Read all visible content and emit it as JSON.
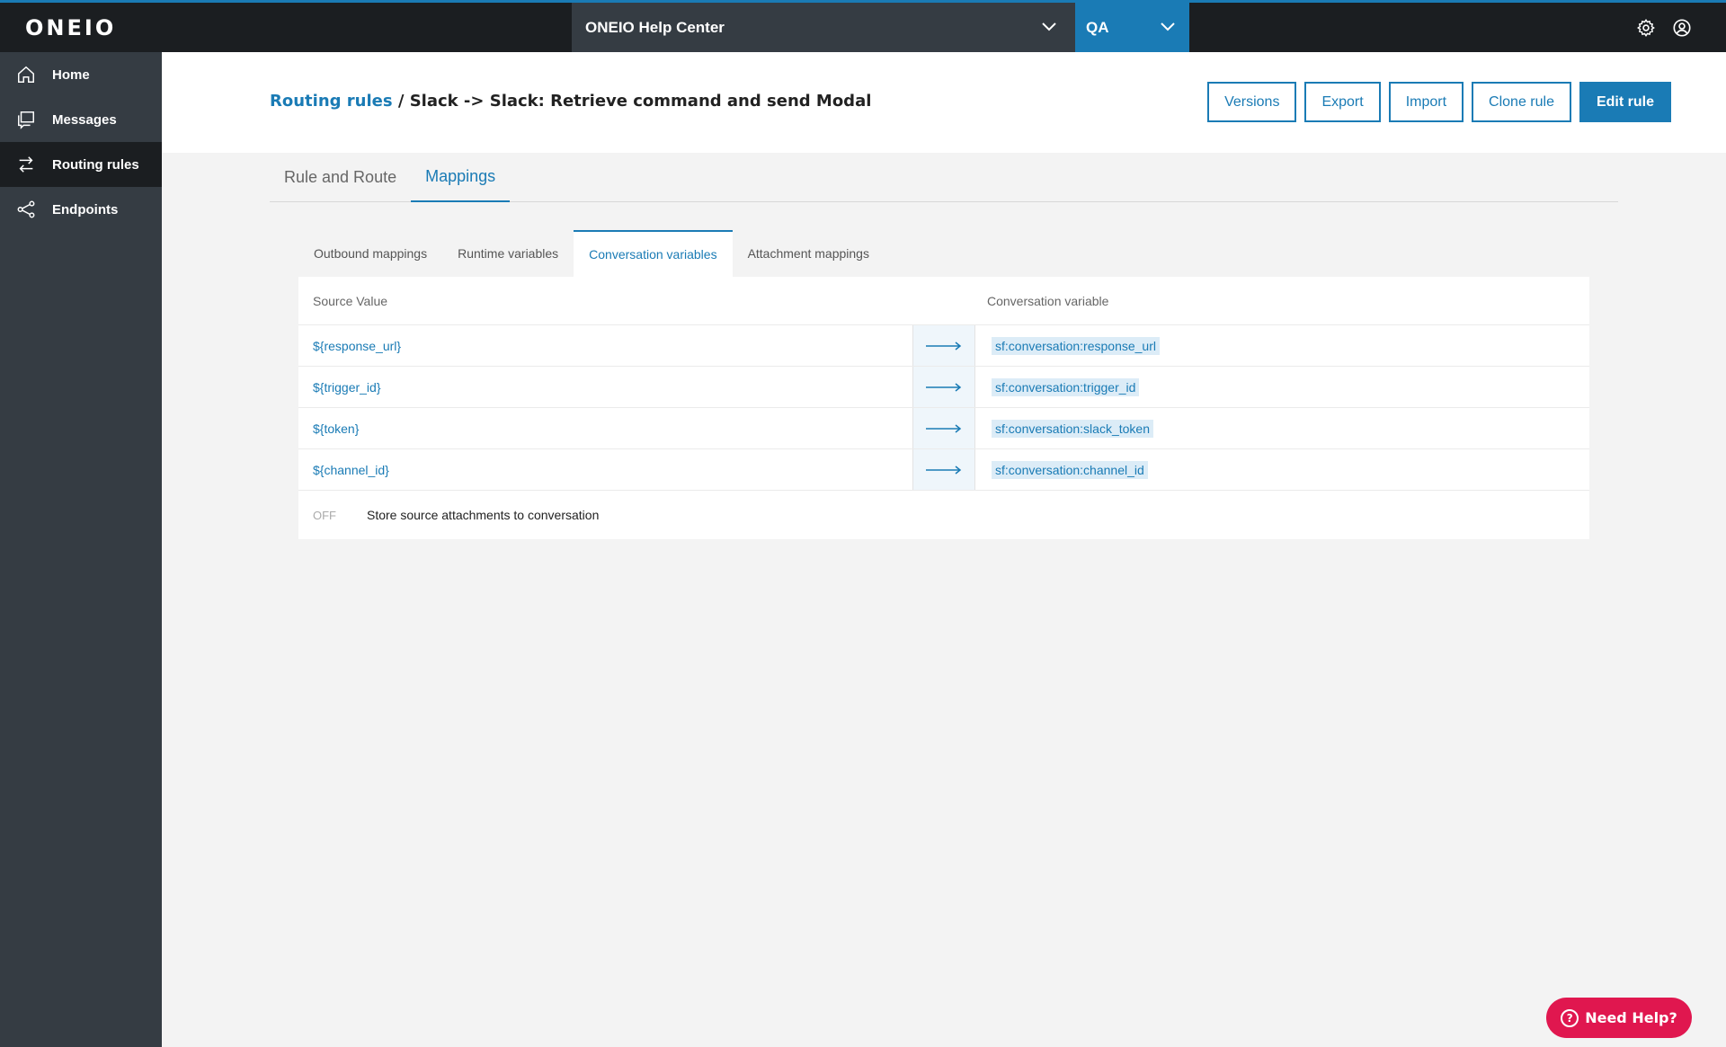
{
  "brand": {
    "logo": "ONEIO",
    "accent": "#1a7bb5",
    "help_color": "#e0174f"
  },
  "topbar": {
    "org": "ONEIO Help Center",
    "env": "QA",
    "icons": [
      "gear-icon",
      "user-account-icon"
    ]
  },
  "sidebar": {
    "items": [
      {
        "label": "Home",
        "icon": "home-icon"
      },
      {
        "label": "Messages",
        "icon": "messages-icon"
      },
      {
        "label": "Routing rules",
        "icon": "routing-icon",
        "active": true
      },
      {
        "label": "Endpoints",
        "icon": "endpoints-icon"
      }
    ]
  },
  "header": {
    "breadcrumb_link": "Routing rules",
    "separator": "/",
    "title": "Slack -> Slack: Retrieve command and send Modal",
    "buttons": {
      "versions": "Versions",
      "export": "Export",
      "import": "Import",
      "clone": "Clone rule",
      "edit": "Edit rule"
    }
  },
  "main_tabs": [
    {
      "label": "Rule and Route",
      "active": false
    },
    {
      "label": "Mappings",
      "active": true
    }
  ],
  "sub_tabs": [
    {
      "label": "Outbound mappings",
      "active": false
    },
    {
      "label": "Runtime variables",
      "active": false
    },
    {
      "label": "Conversation variables",
      "active": true
    },
    {
      "label": "Attachment mappings",
      "active": false
    }
  ],
  "table": {
    "headers": {
      "source": "Source Value",
      "target": "Conversation variable"
    },
    "rows": [
      {
        "source": "${response_url}",
        "target": "sf:conversation:response_url"
      },
      {
        "source": "${trigger_id}",
        "target": "sf:conversation:trigger_id"
      },
      {
        "source": "${token}",
        "target": "sf:conversation:slack_token"
      },
      {
        "source": "${channel_id}",
        "target": "sf:conversation:channel_id"
      }
    ],
    "toggle": {
      "state": "OFF",
      "label": "Store source attachments to conversation"
    }
  },
  "help": {
    "label": "Need Help?"
  }
}
